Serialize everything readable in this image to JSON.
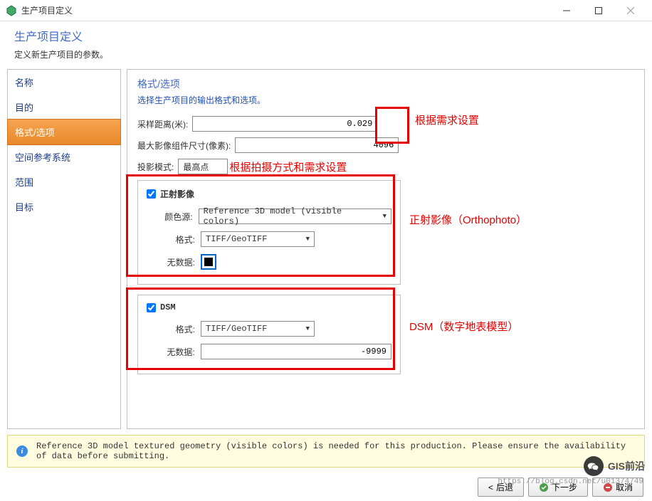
{
  "window": {
    "title": "生产项目定义",
    "header_title": "生产项目定义",
    "header_subtitle": "定义新生产项目的参数。"
  },
  "sidebar": {
    "items": [
      {
        "label": "名称",
        "active": false
      },
      {
        "label": "目的",
        "active": false
      },
      {
        "label": "格式/选项",
        "active": true
      },
      {
        "label": "空间参考系统",
        "active": false
      },
      {
        "label": "范围",
        "active": false
      },
      {
        "label": "目标",
        "active": false
      }
    ]
  },
  "content": {
    "title": "格式/选项",
    "subtitle": "选择生产项目的输出格式和选项。",
    "sampling_label": "采样距离(米):",
    "sampling_value": "0.029",
    "maxsize_label": "最大影像组件尺寸(像素):",
    "maxsize_value": "4096",
    "projection_label": "投影模式:",
    "projection_value": "最高点",
    "ortho": {
      "title": "正射影像",
      "checked": true,
      "colorsrc_label": "颜色源:",
      "colorsrc_value": "Reference 3D model (visible colors)",
      "format_label": "格式:",
      "format_value": "TIFF/GeoTIFF",
      "nodata_label": "无数据:"
    },
    "dsm": {
      "title": "DSM",
      "checked": true,
      "format_label": "格式:",
      "format_value": "TIFF/GeoTIFF",
      "nodata_label": "无数据:",
      "nodata_value": "-9999"
    }
  },
  "annotations": {
    "req_setting": "根据需求设置",
    "proj_setting": "根据拍摄方式和需求设置",
    "ortho_label": "正射影像（Orthophoto）",
    "dsm_label": "DSM（数字地表模型）"
  },
  "info": {
    "text": "Reference 3D model textured geometry (visible colors) is needed for this production. Please ensure the availability of data before submitting."
  },
  "buttons": {
    "back": "后退",
    "next": "下一步",
    "cancel": "取消"
  },
  "watermark": {
    "brand": "GIS前沿",
    "sub": "https://blog.csdn.net/u01374749"
  }
}
